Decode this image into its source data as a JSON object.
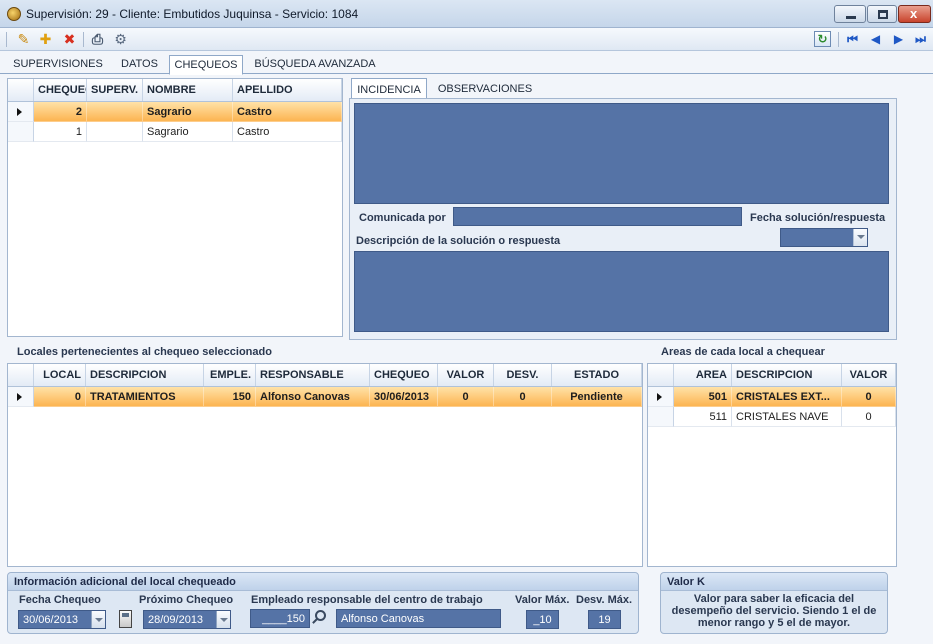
{
  "window": {
    "title": "Supervisión: 29 - Cliente: Embutidos Juquinsa - Servicio: 1084",
    "min_label": "–",
    "close_label": "x"
  },
  "toolbar": {
    "edit": "✎",
    "add": "✚",
    "delete": "✖",
    "print": "⎙",
    "preview": "⚙",
    "refresh": "↻",
    "first": "⏮",
    "prev": "◀",
    "next": "▶",
    "last": "⏭"
  },
  "main_tabs": [
    "SUPERVISIONES",
    "DATOS",
    "CHEQUEOS",
    "BÚSQUEDA AVANZADA"
  ],
  "chequeos": {
    "columns": [
      "CHEQUEO",
      "SUPERV.",
      "NOMBRE",
      "APELLIDO"
    ],
    "rows": [
      {
        "chequeo": "2",
        "superv": "",
        "nombre": "Sagrario",
        "apellido": "Castro"
      },
      {
        "chequeo": "1",
        "superv": "",
        "nombre": "Sagrario",
        "apellido": "Castro"
      }
    ]
  },
  "incidencia": {
    "tabs": [
      "INCIDENCIA",
      "OBSERVACIONES"
    ],
    "comunicada_por_label": "Comunicada por",
    "comunicada_por_value": "",
    "fecha_solucion_label": "Fecha solución/respuesta",
    "fecha_solucion_value": "",
    "descripcion_label": "Descripción de la solución o respuesta"
  },
  "locales": {
    "section_label": "Locales pertenecientes al chequeo seleccionado",
    "columns": [
      "LOCAL",
      "DESCRIPCION",
      "EMPLE.",
      "RESPONSABLE",
      "CHEQUEO",
      "VALOR",
      "DESV.",
      "ESTADO"
    ],
    "rows": [
      {
        "local": "0",
        "descripcion": "TRATAMIENTOS",
        "emple": "150",
        "responsable": "Alfonso Canovas",
        "chequeo": "30/06/2013",
        "valor": "0",
        "desv": "0",
        "estado": "Pendiente"
      }
    ]
  },
  "areas": {
    "section_label": "Areas de cada local a chequear",
    "columns": [
      "AREA",
      "DESCRIPCION",
      "VALOR"
    ],
    "rows": [
      {
        "area": "501",
        "descripcion": "CRISTALES EXT...",
        "valor": "0"
      },
      {
        "area": "511",
        "descripcion": "CRISTALES NAVE",
        "valor": "0"
      }
    ]
  },
  "info": {
    "title": "Información adicional del local chequeado",
    "fecha_chequeo_label": "Fecha Chequeo",
    "fecha_chequeo_value": "30/06/2013",
    "proximo_chequeo_label": "Próximo Chequeo",
    "proximo_chequeo_value": "28/09/2013",
    "empleado_label": "Empleado responsable del centro de trabajo",
    "empleado_code": "____150",
    "empleado_name": "Alfonso Canovas",
    "valor_max_label": "Valor Máx.",
    "valor_max_value": "_10",
    "desv_max_label": "Desv. Máx.",
    "desv_max_value": "19"
  },
  "valor_k": {
    "title": "Valor K",
    "text": "Valor para saber la eficacia del desempeño del servicio. Siendo 1 el de menor rango y 5 el de mayor."
  }
}
